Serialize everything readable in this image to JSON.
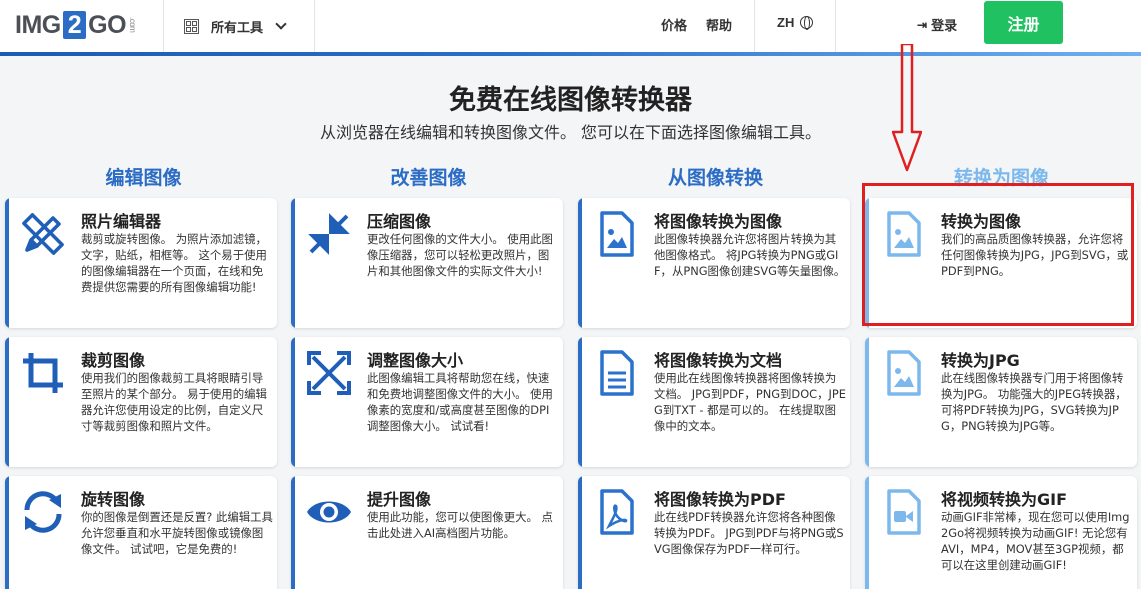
{
  "header": {
    "logo": {
      "before": "IMG",
      "two": "2",
      "after": "GO",
      "suffix": ".com"
    },
    "tools_menu": "所有工具",
    "nav": {
      "pricing": "价格",
      "help": "帮助"
    },
    "language": "ZH",
    "login": "登录",
    "register": "注册"
  },
  "hero": {
    "title": "免费在线图像转换器",
    "subtitle": "从浏览器在线编辑和转换图像文件。 您可以在下面选择图像编辑工具。"
  },
  "columns": [
    {
      "title": "编辑图像",
      "cards": [
        {
          "icon": "pencil-ruler-icon",
          "title": "照片编辑器",
          "desc": "裁剪或旋转图像。 为照片添加滤镜，文字，贴纸，相框等。 这个易于使用的图像编辑器在一个页面，在线和免费提供您需要的所有图像编辑功能!"
        },
        {
          "icon": "crop-icon",
          "title": "裁剪图像",
          "desc": "使用我们的图像裁剪工具将眼睛引导至照片的某个部分。 易于使用的编辑器允许您使用设定的比例，自定义尺寸等裁剪图像和照片文件。"
        },
        {
          "icon": "rotate-icon",
          "title": "旋转图像",
          "desc": "你的图像是倒置还是反置? 此编辑工具允许您垂直和水平旋转图像或镜像图像文件。 试试吧，它是免费的!"
        }
      ]
    },
    {
      "title": "改善图像",
      "cards": [
        {
          "icon": "compress-icon",
          "title": "压缩图像",
          "desc": "更改任何图像的文件大小。 使用此图像压缩器，您可以轻松更改照片，图片和其他图像文件的实际文件大小!"
        },
        {
          "icon": "resize-icon",
          "title": "调整图像大小",
          "desc": "此图像编辑工具将帮助您在线，快速和免费地调整图像文件的大小。 使用像素的宽度和/或高度甚至图像的DPI调整图像大小。 试试看!"
        },
        {
          "icon": "eye-icon",
          "title": "提升图像",
          "desc": "使用此功能，您可以使图像更大。 点击此处进入AI高档图片功能。"
        }
      ]
    },
    {
      "title": "从图像转换",
      "cards": [
        {
          "icon": "image-file-icon",
          "title": "将图像转换为图像",
          "desc": "此图像转换器允许您将图片转换为其他图像格式。 将JPG转换为PNG或GIF，从PNG图像创建SVG等矢量图像。"
        },
        {
          "icon": "document-file-icon",
          "title": "将图像转换为文档",
          "desc": "使用此在线图像转换器将图像转换为文档。 JPG到PDF，PNG到DOC，JPEG到TXT - 都是可以的。 在线提取图像中的文本。"
        },
        {
          "icon": "pdf-file-icon",
          "title": "将图像转换为PDF",
          "desc": "此在线PDF转换器允许您将各种图像转换为PDF。 JPG到PDF与将PNG或SVG图像保存为PDF一样可行。"
        }
      ]
    },
    {
      "title": "转换为图像",
      "cards": [
        {
          "icon": "image-file-icon",
          "title": "转换为图像",
          "desc": "我们的高品质图像转换器，允许您将任何图像转换为JPG，JPG到SVG，或PDF到PNG。"
        },
        {
          "icon": "image-file-icon",
          "title": "转换为JPG",
          "desc": "此在线图像转换器专门用于将图像转换为JPG。 功能强大的JPEG转换器，可将PDF转换为JPG，SVG转换为JPG，PNG转换为JPG等。"
        },
        {
          "icon": "video-file-icon",
          "title": "将视频转换为GIF",
          "desc": "动画GIF非常棒，现在您可以使用Img2Go将视频转换为动画GIF! 无论您有AVI，MP4，MOV甚至3GP视频，都可以在这里创建动画GIF!"
        }
      ]
    }
  ],
  "colors": {
    "accent": "#2b6cc4",
    "accent_light": "#7db8ec",
    "register": "#20c160",
    "highlight": "#e02020"
  }
}
